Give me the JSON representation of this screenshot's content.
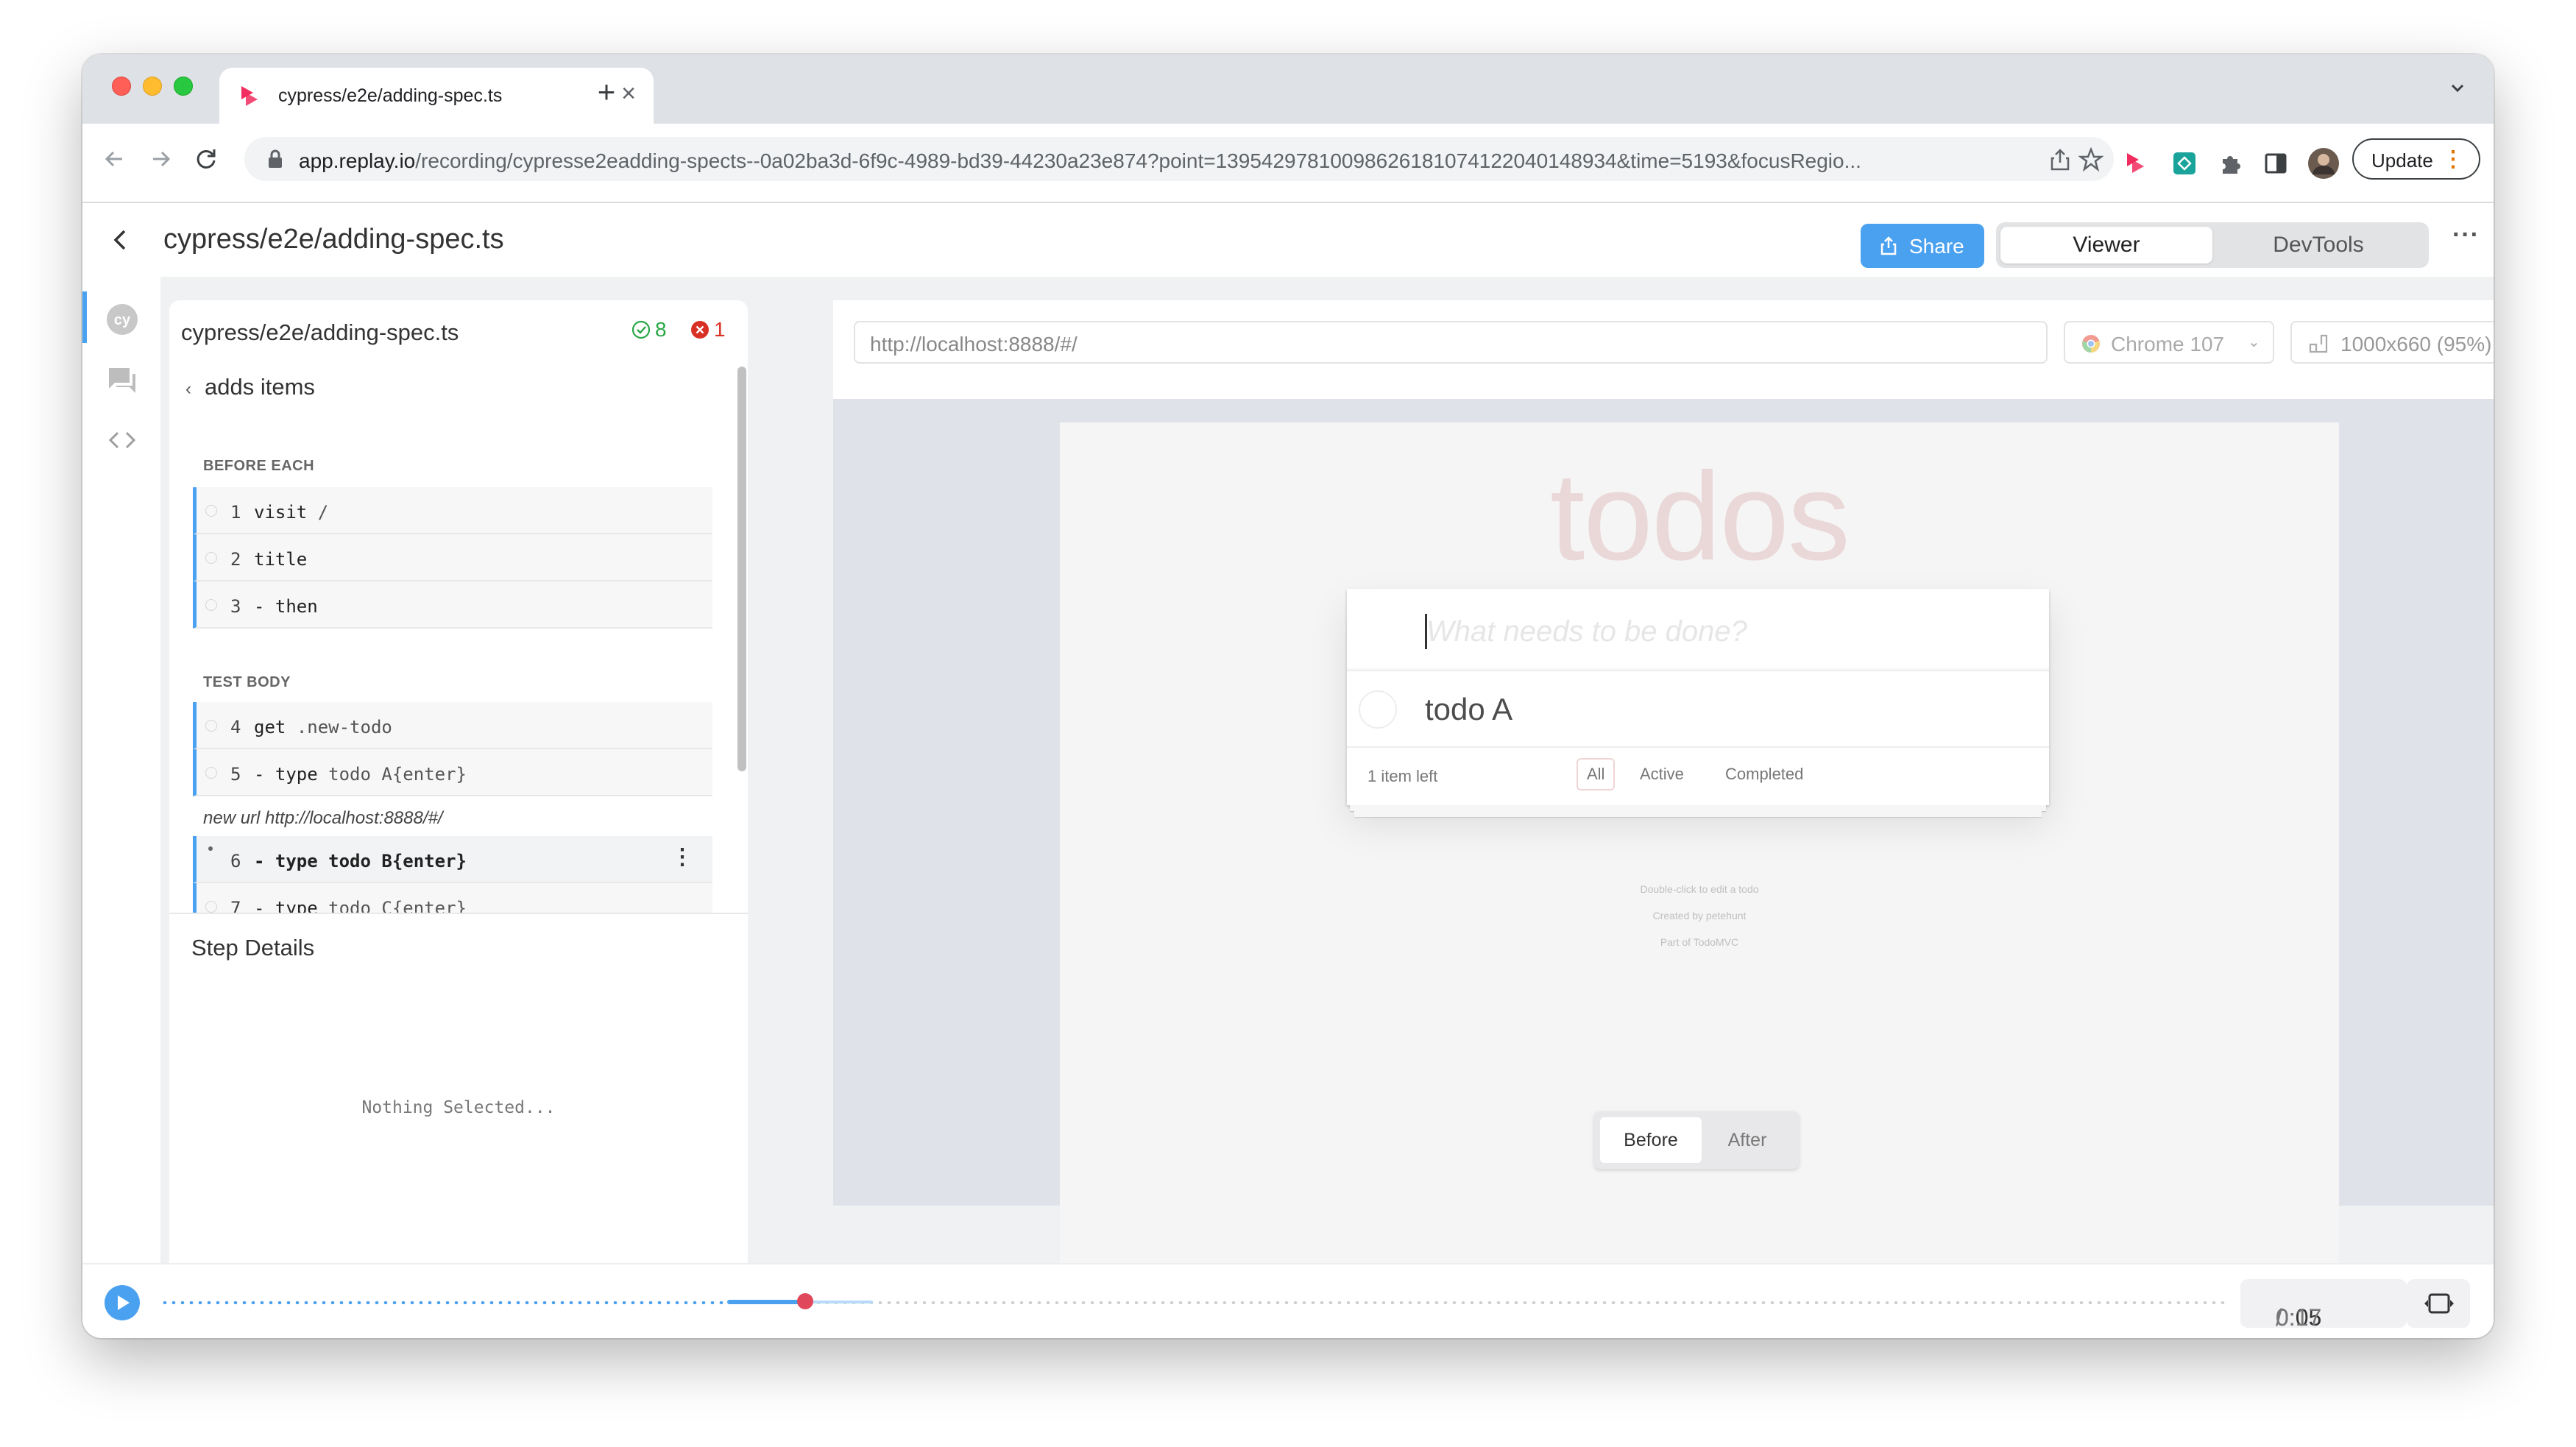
{
  "browser": {
    "tab_title": "cypress/e2e/adding-spec.ts",
    "tab_close": "×",
    "new_tab": "+",
    "url_host": "app.replay.io",
    "url_path": "/recording/cypresse2eadding-spects--0a02ba3d-6f9c-4989-bd39-44230a23e874?point=13954297810098626181074122040148934&time=5193&focusRegio...",
    "update_label": "Update",
    "update_dots": "⋮"
  },
  "header": {
    "back": "back",
    "title": "cypress/e2e/adding-spec.ts",
    "share_label": "Share",
    "viewer_label": "Viewer",
    "devtools_label": "DevTools",
    "more": "···"
  },
  "test_panel": {
    "title": "cypress/e2e/adding-spec.ts",
    "pass_count": "8",
    "fail_count": "1",
    "test_name": "adds items",
    "before_each_label": "BEFORE EACH",
    "test_body_label": "TEST BODY",
    "before_each_steps": [
      {
        "num": "1",
        "cmd": "visit",
        "arg": "/"
      },
      {
        "num": "2",
        "cmd": "title",
        "arg": ""
      },
      {
        "num": "3",
        "cmd": "- then",
        "arg": ""
      }
    ],
    "body_steps": [
      {
        "num": "4",
        "cmd": "get",
        "arg": ".new-todo"
      },
      {
        "num": "5",
        "cmd": "- type",
        "arg": "todo A{enter}"
      },
      {
        "num": "6",
        "cmd": "- type",
        "arg": "todo B{enter}"
      },
      {
        "num": "7",
        "cmd": "- type",
        "arg": "todo C{enter}"
      }
    ],
    "new_url": "new url http://localhost:8888/#/",
    "step_menu": "⋮",
    "details_title": "Step Details",
    "nothing_selected": "Nothing Selected..."
  },
  "viewer": {
    "url": "http://localhost:8888/#/",
    "browser_label": "Chrome 107",
    "viewport_label": "1000x660  (95%)",
    "before_label": "Before",
    "after_label": "After"
  },
  "todo_page": {
    "title": "todos",
    "placeholder": "What needs to be done?",
    "items": [
      "todo A"
    ],
    "count_label": "1 item left",
    "filters": [
      "All",
      "Active",
      "Completed"
    ],
    "selected_filter": "All",
    "info": [
      "Double-click to edit a todo",
      "Created by petehunt",
      "Part of TodoMVC"
    ]
  },
  "timeline": {
    "current_time": "0:05",
    "separator": " / ",
    "total_time": "0:17",
    "progress": 0.31
  },
  "colors": {
    "accent": "#4aa1f0",
    "pass": "#28a745",
    "fail": "#d93025",
    "handle": "#e0475b"
  }
}
